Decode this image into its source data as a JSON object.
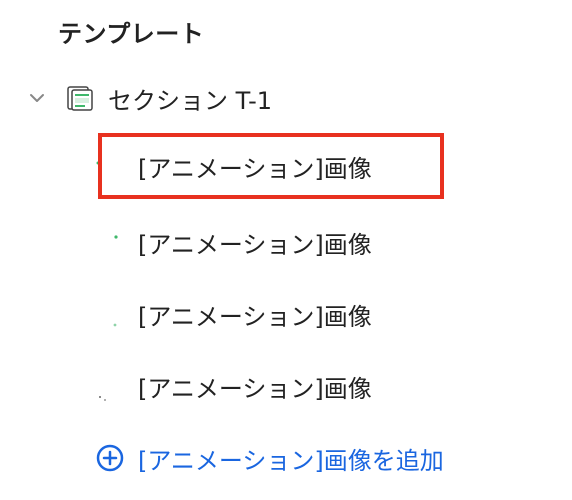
{
  "panel": {
    "heading": "テンプレート"
  },
  "section": {
    "label": "セクション T-1",
    "expanded": true
  },
  "items": [
    {
      "label": "[アニメーション]画像",
      "selected": true
    },
    {
      "label": "[アニメーション]画像",
      "selected": false
    },
    {
      "label": "[アニメーション]画像",
      "selected": false
    },
    {
      "label": "[アニメーション]画像",
      "selected": false
    }
  ],
  "add": {
    "label": "[アニメーション]画像を追加"
  },
  "colors": {
    "accent_blue": "#1a66e0",
    "selection_red": "#e8311f",
    "thumb_green": "#3fb86b"
  },
  "icons": {
    "chevron": "chevron-down-icon",
    "section_thumb": "section-thumbnail-icon",
    "add": "plus-circle-icon"
  }
}
